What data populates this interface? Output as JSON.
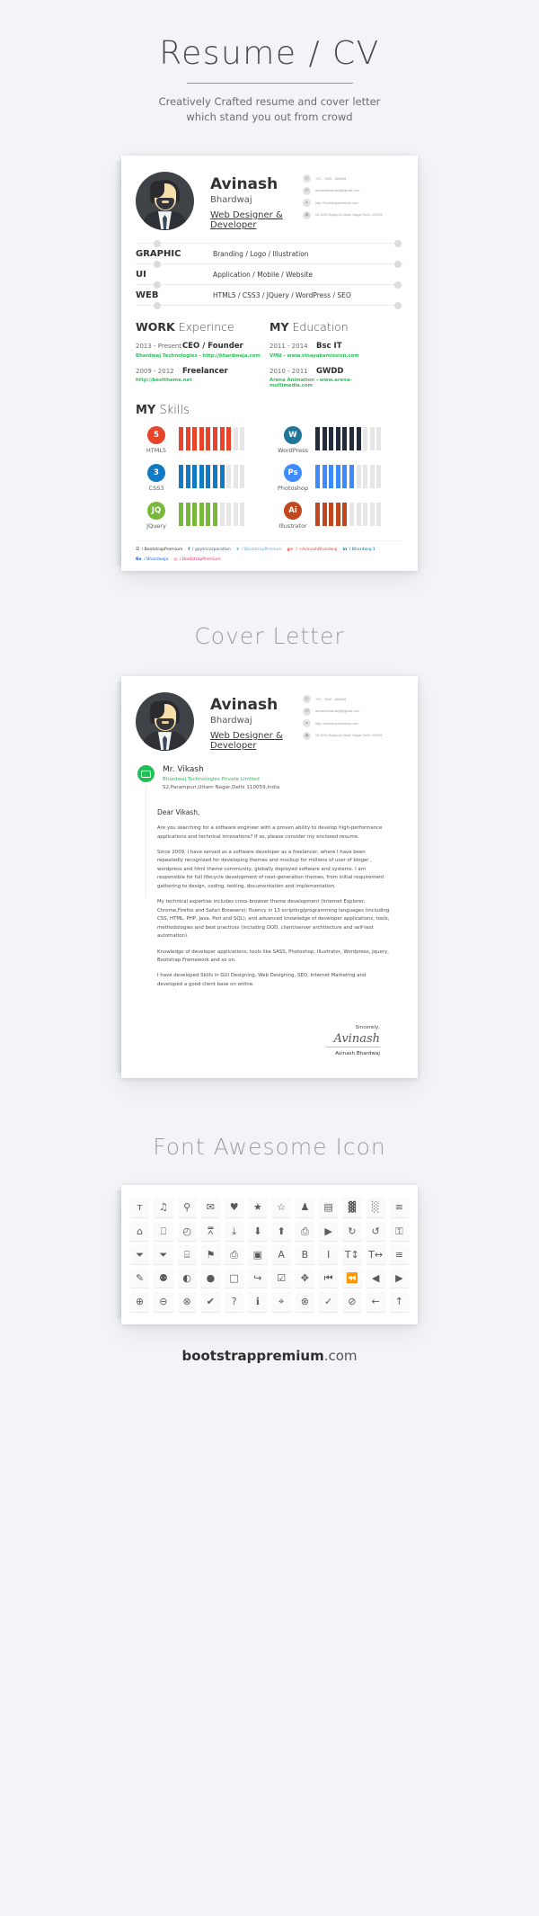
{
  "hero": {
    "title": "Resume / CV",
    "subtitle_line1": "Creatively Crafted resume and cover letter",
    "subtitle_line2": "which stand you out from crowd"
  },
  "sections": {
    "cover_letter_heading": "Cover Letter",
    "icons_heading": "Font Awesome Icon"
  },
  "resume": {
    "profile": {
      "first_name": "Avinash",
      "last_name": "Bhardwaj",
      "role": "Web Designer & Developer"
    },
    "contacts": [
      {
        "icon": "phone-icon",
        "glyph": "✆",
        "text": "+91 - 7840 - 886466"
      },
      {
        "icon": "email-icon",
        "glyph": "✉",
        "text": "avinashbhardwaj@gmail.com"
      },
      {
        "icon": "link-icon",
        "glyph": "⚭",
        "text": "http://bootstrappremium.com"
      },
      {
        "icon": "location-icon",
        "glyph": "◉",
        "text": "S2-S/26 Rajapuri,Uttam Nagar,Delhi 110059"
      }
    ],
    "expertise": [
      {
        "label": "GRAPHIC",
        "value": "Branding / Logo / Illustration"
      },
      {
        "label": "UI",
        "value": "Application / Mobile / Website"
      },
      {
        "label": "WEB",
        "value": "HTML5 / CSS3 / JQuery / WordPress / SEO"
      }
    ],
    "work": {
      "title_bold": "WORK",
      "title_light": "Experince",
      "entries": [
        {
          "date": "2013 - Present",
          "role": "CEO / Founder",
          "meta": "Bhardwaj Technologies   -  http://bhardwaja.com"
        },
        {
          "date": "2009 - 2012",
          "role": "Freelancer",
          "meta": "http://besttheme.net"
        }
      ]
    },
    "education": {
      "title_bold": "MY",
      "title_light": "Education",
      "entries": [
        {
          "date": "2011 - 2014",
          "role": "Bsc IT",
          "meta": "VMU   -  www.vinayakamission.com"
        },
        {
          "date": "2010 - 2011",
          "role": "GWDD",
          "meta": "Arena Animation  -  www.arena-multimedia.com"
        }
      ]
    },
    "skills_title_bold": "MY",
    "skills_title_light": "Skills",
    "skills": [
      {
        "name": "HTML5",
        "badge": "5",
        "badge_color": "#e8442a",
        "bar_color": "#e8442a",
        "filled": 8,
        "total": 10
      },
      {
        "name": "WordPress",
        "badge": "W",
        "badge_color": "#21759b",
        "bar_color": "#232c3d",
        "filled": 7,
        "total": 10
      },
      {
        "name": "CSS3",
        "badge": "3",
        "badge_color": "#1279c4",
        "bar_color": "#1279c4",
        "filled": 7,
        "total": 10
      },
      {
        "name": "Photoshop",
        "badge": "Ps",
        "badge_color": "#3d8bff",
        "bar_color": "#3d8bff",
        "filled": 6,
        "total": 10
      },
      {
        "name": "JQuery",
        "badge": "JQ",
        "badge_color": "#78b83a",
        "bar_color": "#78b83a",
        "filled": 6,
        "total": 10
      },
      {
        "name": "Illustrator",
        "badge": "Ai",
        "badge_color": "#c0471f",
        "bar_color": "#c0471f",
        "filled": 5,
        "total": 10
      }
    ],
    "social": [
      {
        "icon": "behance-icon",
        "glyph": "☲",
        "text": "/ BootstrapPremium",
        "color": "#333333"
      },
      {
        "icon": "facebook-icon",
        "glyph": "f",
        "text": "/ gaytricorporation",
        "color": "#3b5998"
      },
      {
        "icon": "twitter-icon",
        "glyph": "❦",
        "text": "/ BootstrapPremum",
        "color": "#55acee"
      },
      {
        "icon": "googleplus-icon",
        "glyph": "g+",
        "text": "/ +AvinashBhardwaj",
        "color": "#dd4b39"
      },
      {
        "icon": "linkedin-icon",
        "glyph": "in",
        "text": "/ Bhardwaj-1",
        "color": "#0077b5"
      },
      {
        "icon": "behance-alt-icon",
        "glyph": "Be",
        "text": "/ Bhardwaja",
        "color": "#1769ff"
      },
      {
        "icon": "instagram-icon",
        "glyph": "◎",
        "text": "/ BootstrapPremium",
        "color": "#e1306c"
      }
    ]
  },
  "cover_letter": {
    "profile": {
      "first_name": "Avinash",
      "last_name": "Bhardwaj",
      "role": "Web Designer & Developer"
    },
    "contacts": [
      {
        "icon": "phone-icon",
        "glyph": "✆",
        "text": "+91 - 7840 - 886466"
      },
      {
        "icon": "email-icon",
        "glyph": "✉",
        "text": "avinashbhardwaj@gmail.com"
      },
      {
        "icon": "link-icon",
        "glyph": "⚭",
        "text": "http://bootstrappremium.com"
      },
      {
        "icon": "location-icon",
        "glyph": "◉",
        "text": "S2-S/26 Rajapuri,Uttam Nagar,Delhi 110059"
      }
    ],
    "recipient_name": "Mr. Vikash",
    "recipient_company": "Bhardwaj Technologies Private Limited",
    "recipient_address": "S2,Parampuri,Uttam Nagar,Delhi 110059,India",
    "greeting": "Dear Vikash,",
    "paragraphs": [
      "Are you searching for a software engineer with a proven ability to develop high-performance applications and technical innovations? If so, please consider my enclosed resume.",
      "Since 2009, I have served as a software developer as a freelancer, where I have been repeatedly recognized for developing themes and mockup for millions of user of bloger , wordpress and html theme community, globally deployed software and systems. I am responsible for full lifecycle development of next-generation themes, from initial requirement gathering to design, coding, testing, documentation and implementation.",
      "My technical expertise includes cross-browser theme development (Internet Explorer, Chrome,Firefox and Safari Browsers); fluency in 13 scripting/programming languages (including CSS, HTML, PHP, Java, Perl and SQL); and advanced knowledge of developer applications, tools, methodologies and best practices (including OOD, client/server architecture and self-test automation).",
      "Knowledge of developer applications, tools like SASS, Photoshop, Illustrator, Wordpress, Jquery, Bootstrap Framework and so on.",
      "I have developed Skills in GUI Designing, Web Designing, SEO, Internet Marketing and developed a good client base on online."
    ],
    "sincerely": "Sincerely,",
    "signature_scribble": "Avinash",
    "signer": "Avinash Bhardwaj"
  },
  "icon_grid": {
    "rows": [
      [
        {
          "name": "martini-icon",
          "glyph": "ᴛ"
        },
        {
          "name": "music-icon",
          "glyph": "♫"
        },
        {
          "name": "search-icon",
          "glyph": "⚲"
        },
        {
          "name": "envelope-icon",
          "glyph": "✉"
        },
        {
          "name": "heart-icon",
          "glyph": "♥"
        },
        {
          "name": "star-icon",
          "glyph": "★"
        },
        {
          "name": "star-outline-icon",
          "glyph": "☆"
        },
        {
          "name": "user-icon",
          "glyph": "♟"
        },
        {
          "name": "film-icon",
          "glyph": "▤"
        },
        {
          "name": "th-large-icon",
          "glyph": "▓"
        },
        {
          "name": "th-icon",
          "glyph": "░"
        },
        {
          "name": "th-list-icon",
          "glyph": "≡"
        }
      ],
      [
        {
          "name": "home-icon",
          "glyph": "⌂"
        },
        {
          "name": "file-icon",
          "glyph": "⎕"
        },
        {
          "name": "clock-icon",
          "glyph": "◴"
        },
        {
          "name": "road-icon",
          "glyph": "⩞"
        },
        {
          "name": "download-alt-icon",
          "glyph": "⤓"
        },
        {
          "name": "download-icon",
          "glyph": "⬇"
        },
        {
          "name": "upload-icon",
          "glyph": "⬆"
        },
        {
          "name": "inbox-icon",
          "glyph": "⎙"
        },
        {
          "name": "play-circle-icon",
          "glyph": "▶"
        },
        {
          "name": "repeat-icon",
          "glyph": "↻"
        },
        {
          "name": "refresh-icon",
          "glyph": "↺"
        },
        {
          "name": "lock-icon",
          "glyph": "⚿"
        }
      ],
      [
        {
          "name": "tag-icon",
          "glyph": "⏷"
        },
        {
          "name": "tags-icon",
          "glyph": "⏷"
        },
        {
          "name": "book-icon",
          "glyph": "⌸"
        },
        {
          "name": "bookmark-icon",
          "glyph": "⚑"
        },
        {
          "name": "print-icon",
          "glyph": "⎙"
        },
        {
          "name": "camera-icon",
          "glyph": "▣"
        },
        {
          "name": "font-icon",
          "glyph": "A"
        },
        {
          "name": "bold-icon",
          "glyph": "B"
        },
        {
          "name": "italic-icon",
          "glyph": "I"
        },
        {
          "name": "text-height-icon",
          "glyph": "T↕"
        },
        {
          "name": "text-width-icon",
          "glyph": "T↔"
        },
        {
          "name": "align-left-icon",
          "glyph": "≡"
        }
      ],
      [
        {
          "name": "pencil-icon",
          "glyph": "✎"
        },
        {
          "name": "map-marker-icon",
          "glyph": "⚉"
        },
        {
          "name": "adjust-icon",
          "glyph": "◐"
        },
        {
          "name": "tint-icon",
          "glyph": "●"
        },
        {
          "name": "edit-icon",
          "glyph": "□"
        },
        {
          "name": "share-icon",
          "glyph": "↪"
        },
        {
          "name": "check-icon",
          "glyph": "☑"
        },
        {
          "name": "move-icon",
          "glyph": "✥"
        },
        {
          "name": "step-backward-icon",
          "glyph": "⏮"
        },
        {
          "name": "fast-backward-icon",
          "glyph": "⏪"
        },
        {
          "name": "backward-icon",
          "glyph": "◀"
        },
        {
          "name": "play-icon",
          "glyph": "▶"
        }
      ],
      [
        {
          "name": "plus-circle-icon",
          "glyph": "⊕"
        },
        {
          "name": "minus-circle-icon",
          "glyph": "⊖"
        },
        {
          "name": "remove-circle-icon",
          "glyph": "⊗"
        },
        {
          "name": "ok-circle-icon",
          "glyph": "✔"
        },
        {
          "name": "question-circle-icon",
          "glyph": "?"
        },
        {
          "name": "info-circle-icon",
          "glyph": "ℹ"
        },
        {
          "name": "screenshot-icon",
          "glyph": "⌖"
        },
        {
          "name": "remove-sign-icon",
          "glyph": "⊗"
        },
        {
          "name": "ok-sign-icon",
          "glyph": "✓"
        },
        {
          "name": "ban-circle-icon",
          "glyph": "⊘"
        },
        {
          "name": "arrow-left-icon",
          "glyph": "←"
        },
        {
          "name": "arrow-up-icon",
          "glyph": "↑"
        }
      ]
    ]
  },
  "footer": {
    "brand_bold": "bootstrappremium",
    "brand_light": ".com"
  }
}
